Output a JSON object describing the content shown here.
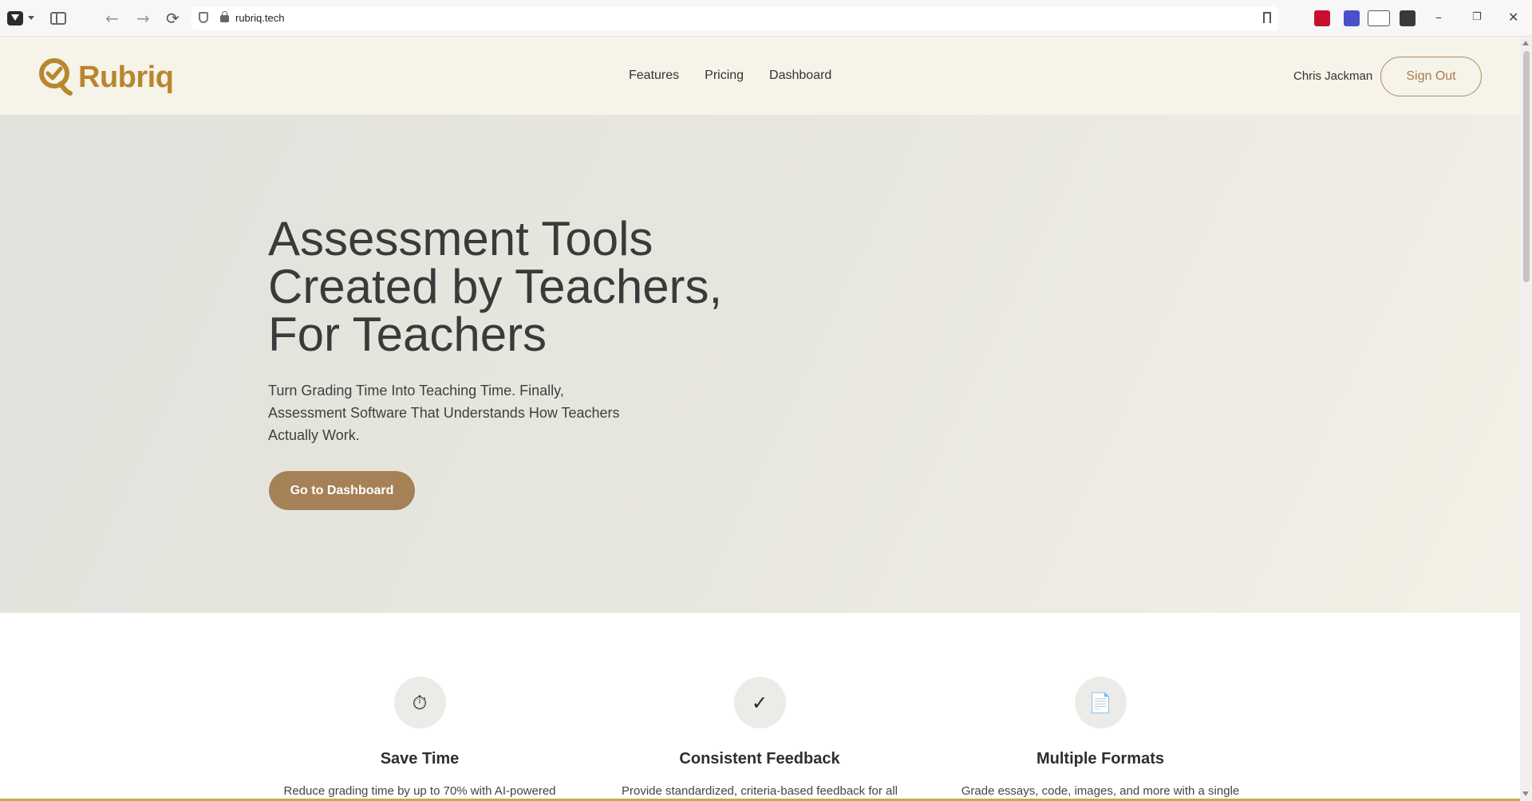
{
  "browser": {
    "url": "rubriq.tech",
    "back": "←",
    "forward": "→",
    "reload": "⟳",
    "minimize": "–",
    "restore": "❐",
    "close": "✕",
    "extensions": [
      "pdf-extension-icon",
      "p-extension-icon",
      "vpn-extension-icon",
      "gift-extension-icon"
    ]
  },
  "header": {
    "brand": "Rubriq",
    "nav": [
      "Features",
      "Pricing",
      "Dashboard"
    ],
    "user_name": "Chris Jackman",
    "sign_out": "Sign Out"
  },
  "hero": {
    "title_line1": "Assessment Tools",
    "title_line2": "Created by Teachers,",
    "title_line3": "For Teachers",
    "subtitle": "Turn Grading Time Into Teaching Time. Finally, Assessment Software That Understands How Teachers Actually Work.",
    "cta": "Go to Dashboard"
  },
  "features": [
    {
      "icon": "stopwatch-icon",
      "glyph": "⏱",
      "title": "Save Time",
      "desc": "Reduce grading time by up to 70% with AI-powered"
    },
    {
      "icon": "checkmark-icon",
      "glyph": "✓",
      "title": "Consistent Feedback",
      "desc": "Provide standardized, criteria-based feedback for all"
    },
    {
      "icon": "document-icon",
      "glyph": "📄",
      "title": "Multiple Formats",
      "desc": "Grade essays, code, images, and more with a single"
    }
  ],
  "colors": {
    "brand": "#b8862f",
    "cta": "#a68157",
    "header_bg": "#f6f3e8",
    "accent_line": "#c9a94d"
  }
}
